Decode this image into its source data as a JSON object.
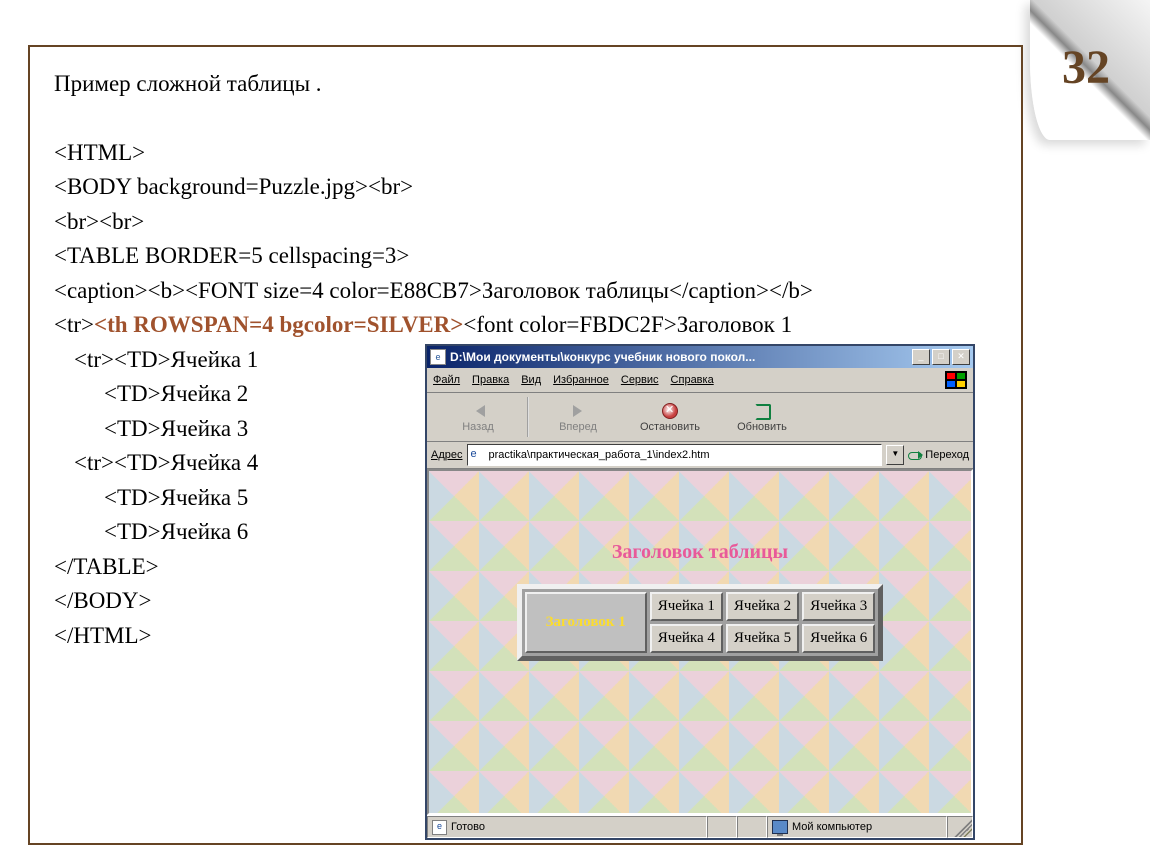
{
  "slide": {
    "number": "32",
    "title": "Пример сложной таблицы .",
    "code_lines": [
      "<HTML>",
      "<BODY background=Puzzle.jpg><br>",
      "<br><br>",
      "<TABLE BORDER=5 cellspacing=3>",
      "<caption><b><FONT size=4 color=E88CB7>Заголовок таблицы</caption></b>",
      "<tr>",
      "<th  ROWSPAN=4  bgcolor=SILVER>",
      "<font color=FBDC2F>Заголовок 1",
      "<tr><TD>Ячейка 1",
      "<TD>Ячейка 2",
      "<TD>Ячейка 3",
      "<tr><TD>Ячейка 4",
      "<TD>Ячейка 5",
      "<TD>Ячейка 6",
      "</TABLE>",
      "</BODY>",
      "</HTML>"
    ]
  },
  "ie": {
    "title": "D:\\Мои документы\\конкурс учебник нового покол...",
    "menu": {
      "file": "Файл",
      "edit": "Правка",
      "view": "Вид",
      "favorites": "Избранное",
      "tools": "Сервис",
      "help": "Справка"
    },
    "toolbar": {
      "back": "Назад",
      "forward": "Вперед",
      "stop": "Остановить",
      "refresh": "Обновить"
    },
    "address_label": "Адрес",
    "address_url": "practika\\практическая_работа_1\\index2.htm",
    "go_label": "Переход",
    "content": {
      "caption": "Заголовок таблицы",
      "row_header": "Заголовок 1",
      "cells": {
        "c1": "Ячейка 1",
        "c2": "Ячейка 2",
        "c3": "Ячейка 3",
        "c4": "Ячейка 4",
        "c5": "Ячейка 5",
        "c6": "Ячейка 6"
      }
    },
    "status": {
      "ready": "Готово",
      "zone": "Мой компьютер"
    }
  }
}
